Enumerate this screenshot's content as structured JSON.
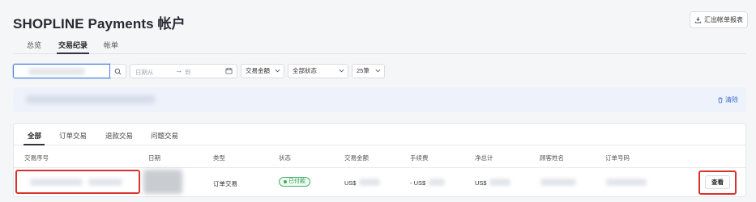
{
  "header": {
    "title": "SHOPLINE Payments 帐户",
    "export_label": "汇出帐单报表"
  },
  "top_tabs": [
    {
      "label": "总览",
      "active": false
    },
    {
      "label": "交易纪录",
      "active": true
    },
    {
      "label": "帐单",
      "active": false
    }
  ],
  "filters": {
    "date_from_placeholder": "日期从",
    "date_arrow": "→",
    "date_to_placeholder": "到",
    "amount_select": "交易金額",
    "status_select": "全部狀态",
    "page_size_select": "25筆"
  },
  "banner": {
    "clear_label": "清除"
  },
  "sub_tabs": [
    {
      "label": "全部",
      "active": true
    },
    {
      "label": "订单交易",
      "active": false
    },
    {
      "label": "退款交易",
      "active": false
    },
    {
      "label": "问题交易",
      "active": false
    }
  ],
  "table": {
    "columns": [
      "交易序号",
      "日期",
      "类型",
      "状态",
      "交易金额",
      "手续费",
      "净总计",
      "顾客姓名",
      "订单号码"
    ],
    "row": {
      "type": "订单交易",
      "status": "已付款",
      "amount_prefix": "US$",
      "fee_prefix": "- US$",
      "net_prefix": "US$",
      "view_label": "查看"
    }
  },
  "colors": {
    "accent": "#3d6fd1",
    "status_green": "#2e9a55",
    "highlight_red": "#d8322f"
  }
}
